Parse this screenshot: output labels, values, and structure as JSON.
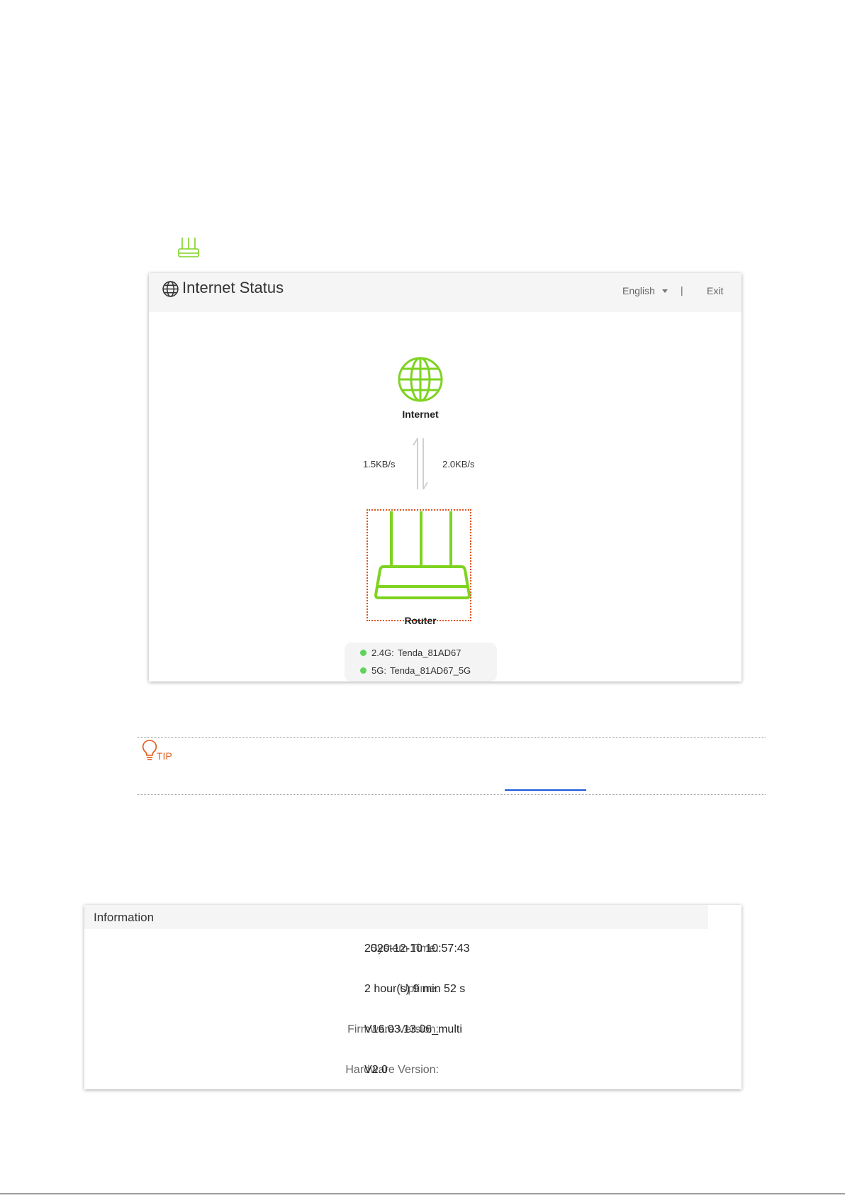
{
  "status_panel": {
    "title": "Internet Status",
    "language": "English",
    "divider": "|",
    "exit": "Exit",
    "internet_label": "Internet",
    "upload_speed": "1.5KB/s",
    "download_speed": "2.0KB/s",
    "router_label": "Router",
    "wifi": [
      {
        "band": "2.4G:",
        "ssid": "Tenda_81AD67"
      },
      {
        "band": "5G:",
        "ssid": "Tenda_81AD67_5G"
      }
    ]
  },
  "tip": {
    "label": "TIP"
  },
  "info_panel": {
    "title": "Information",
    "rows": [
      {
        "label": "System Time:",
        "value": "2020-12-10 10:57:43"
      },
      {
        "label": "Uptime:",
        "value": "2 hour(s) 9 min 52 s"
      },
      {
        "label": "Firmware Version:",
        "value": "V16.03.13.06_multi"
      },
      {
        "label": "Hardware Version:",
        "value": "V2.0"
      }
    ]
  },
  "colors": {
    "accent_green": "#7ed321",
    "highlight_orange": "#e0531c",
    "tip_orange": "#e45b1c",
    "link_blue": "#1a56db"
  },
  "icons": [
    "router-icon",
    "globe-icon",
    "transfer-arrows-icon",
    "bulb-icon",
    "caret-down-icon"
  ]
}
